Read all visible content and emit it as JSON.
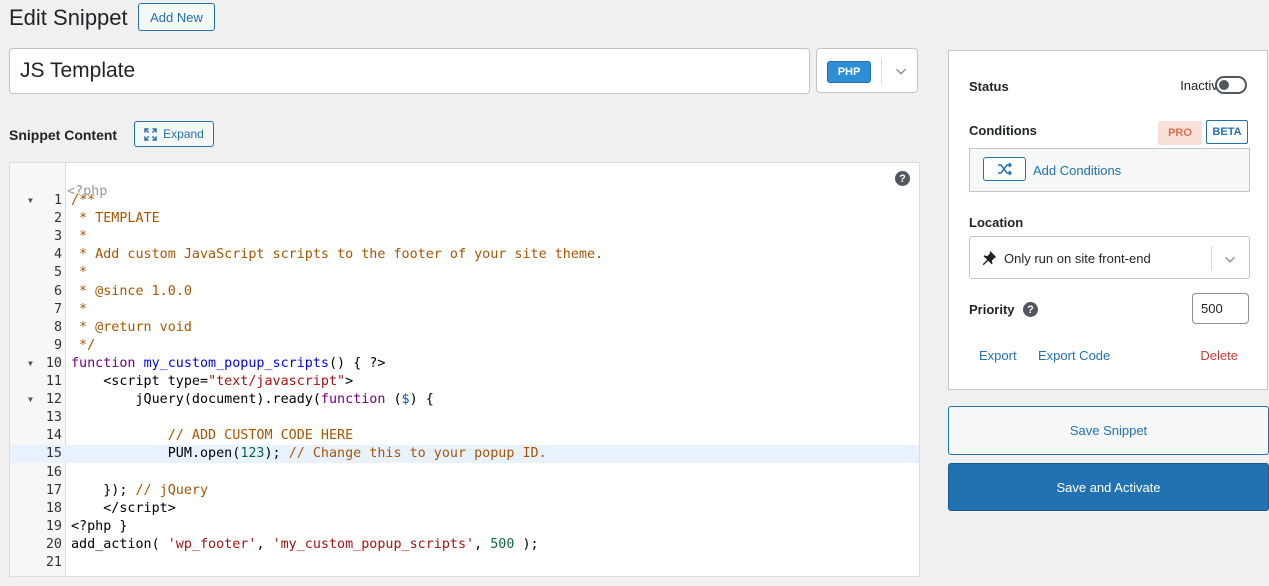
{
  "header": {
    "title": "Edit Snippet",
    "add_new_label": "Add New"
  },
  "snippet": {
    "title_value": "JS Template",
    "language_badge": "PHP"
  },
  "content": {
    "label": "Snippet Content",
    "expand_label": "Expand",
    "help_glyph": "?"
  },
  "code": {
    "pre_line": "<?php",
    "active_line": 15,
    "lines": [
      {
        "num": "1",
        "fold": true,
        "html": "<span class=\"c-comment\">/**</span>"
      },
      {
        "num": "2",
        "html": "<span class=\"c-comment\"> * TEMPLATE</span>"
      },
      {
        "num": "3",
        "html": "<span class=\"c-comment\"> *</span>"
      },
      {
        "num": "4",
        "html": "<span class=\"c-comment\"> * Add custom JavaScript scripts to the footer of your site theme.</span>"
      },
      {
        "num": "5",
        "html": "<span class=\"c-comment\"> *</span>"
      },
      {
        "num": "6",
        "html": "<span class=\"c-comment\"> * @since 1.0.0</span>"
      },
      {
        "num": "7",
        "html": "<span class=\"c-comment\"> *</span>"
      },
      {
        "num": "8",
        "html": "<span class=\"c-comment\"> * @return void</span>"
      },
      {
        "num": "9",
        "html": "<span class=\"c-comment\"> */</span>"
      },
      {
        "num": "10",
        "fold": true,
        "html": "<span class=\"c-kw\">function</span> <span class=\"c-def\">my_custom_popup_scripts</span>() { ?&gt;"
      },
      {
        "num": "11",
        "html": "    &lt;script type=<span class=\"c-str\">\"text/javascript\"</span>&gt;"
      },
      {
        "num": "12",
        "fold": true,
        "html": "        jQuery(document).ready(<span class=\"c-kw\">function</span> (<span class=\"c-var\">$</span>) {"
      },
      {
        "num": "13",
        "html": ""
      },
      {
        "num": "14",
        "html": "            <span class=\"c-cm2\">// ADD CUSTOM CODE HERE</span>"
      },
      {
        "num": "15",
        "html": "            PUM.open(<span class=\"c-num\">123</span>); <span class=\"c-cm2\">// Change this to your popup ID.</span>"
      },
      {
        "num": "16",
        "html": ""
      },
      {
        "num": "17",
        "html": "    }); <span class=\"c-cm2\">// jQuery</span>"
      },
      {
        "num": "18",
        "html": "    &lt;/script&gt;"
      },
      {
        "num": "19",
        "html": "&lt;?php }"
      },
      {
        "num": "20",
        "html": "add_action( <span class=\"c-str\">'wp_footer'</span>, <span class=\"c-str\">'my_custom_popup_scripts'</span>, <span class=\"c-num\">500</span> );"
      },
      {
        "num": "21",
        "html": ""
      }
    ]
  },
  "sidebar": {
    "status_label": "Status",
    "status_value": "Inactive",
    "conditions_label": "Conditions",
    "pro_badge": "PRO",
    "beta_badge": "BETA",
    "add_conditions_label": "Add Conditions",
    "location_label": "Location",
    "location_value": "Only run on site front-end",
    "priority_label": "Priority",
    "priority_help": "?",
    "priority_value": "500",
    "export_label": "Export",
    "export_code_label": "Export Code",
    "delete_label": "Delete"
  },
  "actions": {
    "save_label": "Save Snippet",
    "save_activate_label": "Save and Activate"
  },
  "colors": {
    "accent": "#2271b1",
    "danger": "#d63638",
    "pro": "#d6714c",
    "php_badge": "#2c8fd6"
  }
}
